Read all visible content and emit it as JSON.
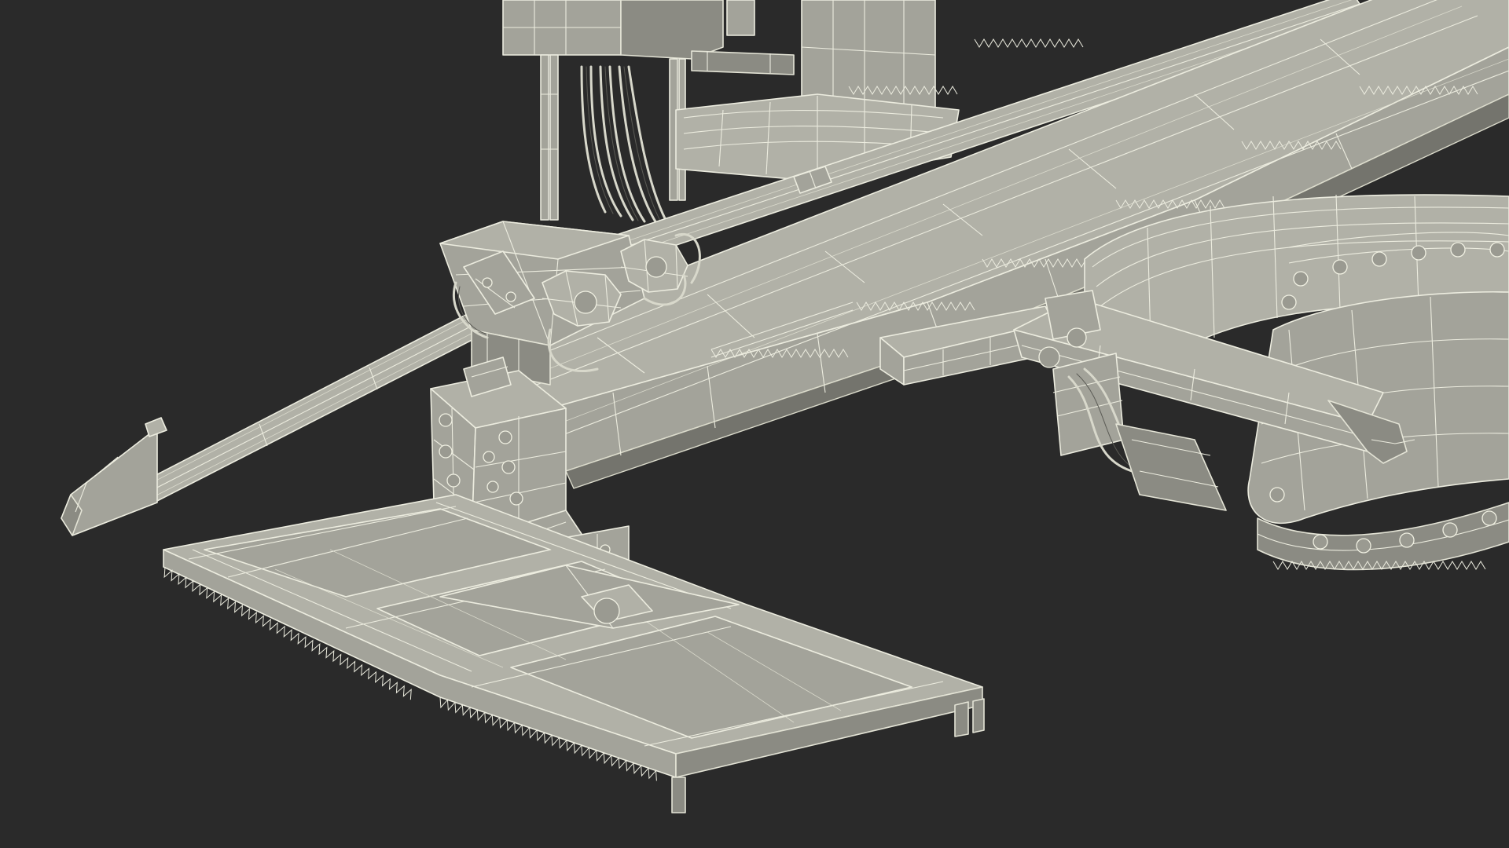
{
  "scene": {
    "background_color": "#2a2a2a",
    "model_fill_color": "#a3a39a",
    "wireframe_color": "#ececdf",
    "render_style": "wireframe-on-shaded"
  }
}
